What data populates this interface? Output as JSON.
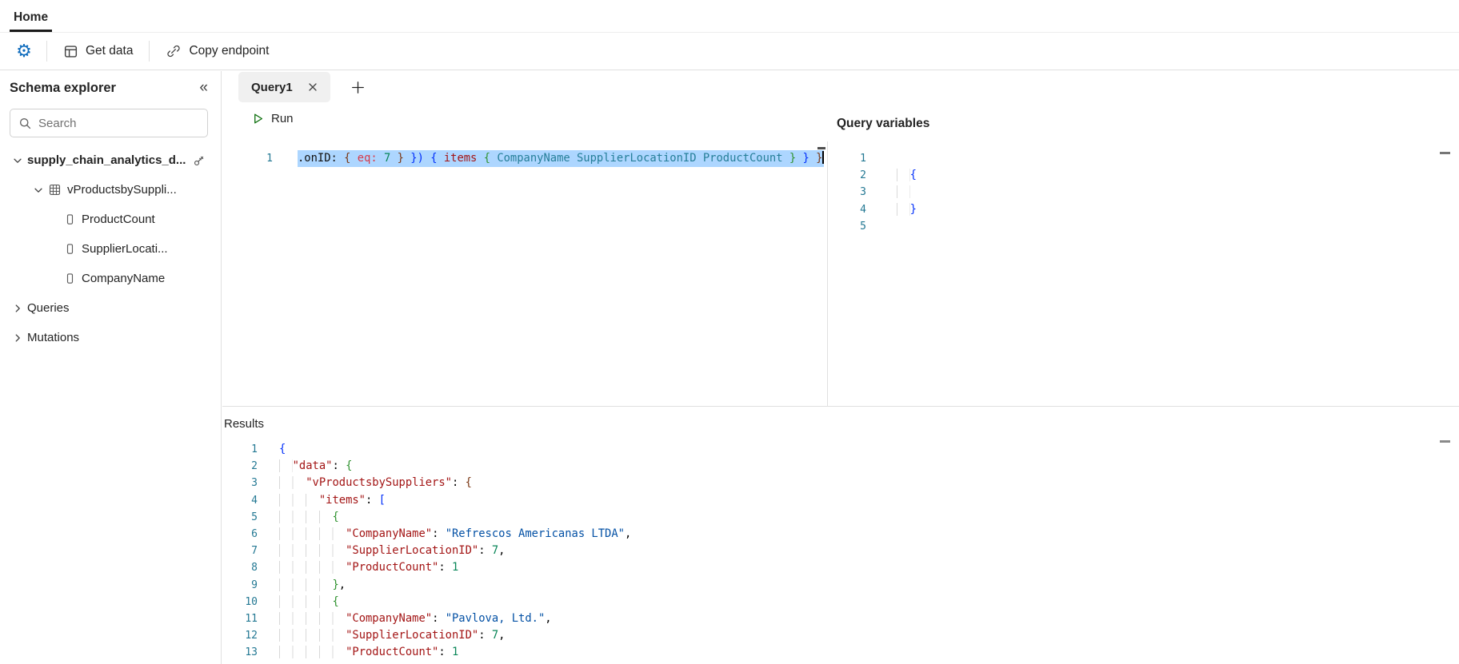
{
  "palette": {
    "accent": "#0f6cbd",
    "run_green": "#0e700e",
    "line_number": "#237893",
    "selection": "#add6ff"
  },
  "header": {
    "home_tab": "Home"
  },
  "toolbar": {
    "get_data": "Get data",
    "copy_endpoint": "Copy endpoint"
  },
  "sidebar": {
    "title": "Schema explorer",
    "search_placeholder": "Search",
    "tree": [
      {
        "label": "supply_chain_analytics_d...",
        "icon": "database-source",
        "expanded": true
      },
      {
        "label": "vProductsbySuppli...",
        "icon": "table",
        "expanded": true
      },
      {
        "label": "ProductCount",
        "icon": "column"
      },
      {
        "label": "SupplierLocati...",
        "icon": "column"
      },
      {
        "label": "CompanyName",
        "icon": "column"
      },
      {
        "label": "Queries",
        "expanded": false
      },
      {
        "label": "Mutations",
        "expanded": false
      }
    ]
  },
  "editor": {
    "tab_label": "Query1",
    "run_label": "Run",
    "query_variables_title": "Query variables",
    "query_lines": [
      {
        "sel": true,
        "caret": true,
        "tokens": [
          [
            ".onID:",
            "q"
          ],
          [
            " ",
            "q"
          ],
          [
            "{",
            "b3"
          ],
          [
            " ",
            "q"
          ],
          [
            "eq:",
            "arg"
          ],
          [
            " ",
            "q"
          ],
          [
            "7",
            "n"
          ],
          [
            " ",
            "q"
          ],
          [
            "}",
            "b3"
          ],
          [
            " ",
            "q"
          ],
          [
            "})",
            "b1"
          ],
          [
            " ",
            "q"
          ],
          [
            "{",
            "b1"
          ],
          [
            " ",
            "q"
          ],
          [
            "items",
            "k"
          ],
          [
            " ",
            "q"
          ],
          [
            "{",
            "b2"
          ],
          [
            " ",
            "q"
          ],
          [
            "CompanyName",
            "fld"
          ],
          [
            " ",
            "q"
          ],
          [
            "SupplierLocationID",
            "fld"
          ],
          [
            " ",
            "q"
          ],
          [
            "ProductCount",
            "fld"
          ],
          [
            " ",
            "q"
          ],
          [
            "}",
            "b2"
          ],
          [
            " ",
            "q"
          ],
          [
            "}",
            "b1"
          ],
          [
            " ",
            "q"
          ],
          [
            "}",
            "b3"
          ]
        ]
      }
    ],
    "variables_lines": [
      {
        "tokens": []
      },
      {
        "tokens": [
          [
            "  ",
            "ind"
          ],
          [
            "{",
            "b1"
          ]
        ]
      },
      {
        "tokens": [
          [
            "  ",
            "ind"
          ]
        ]
      },
      {
        "tokens": [
          [
            "  ",
            "ind"
          ],
          [
            "}",
            "b1"
          ]
        ]
      },
      {
        "tokens": []
      }
    ]
  },
  "results": {
    "title": "Results",
    "lines": [
      {
        "tokens": [
          [
            "{",
            "b1"
          ]
        ]
      },
      {
        "tokens": [
          [
            "  ",
            "ind"
          ],
          [
            "\"data\"",
            "k"
          ],
          [
            ": ",
            "p"
          ],
          [
            "{",
            "b2"
          ]
        ]
      },
      {
        "tokens": [
          [
            "    ",
            "ind"
          ],
          [
            "\"vProductsbySuppliers\"",
            "k"
          ],
          [
            ": ",
            "p"
          ],
          [
            "{",
            "b3"
          ]
        ]
      },
      {
        "tokens": [
          [
            "      ",
            "ind"
          ],
          [
            "\"items\"",
            "k"
          ],
          [
            ": ",
            "p"
          ],
          [
            "[",
            "b1"
          ]
        ]
      },
      {
        "tokens": [
          [
            "        ",
            "ind"
          ],
          [
            "{",
            "b2"
          ]
        ]
      },
      {
        "tokens": [
          [
            "          ",
            "ind"
          ],
          [
            "\"CompanyName\"",
            "k"
          ],
          [
            ": ",
            "p"
          ],
          [
            "\"Refrescos Americanas LTDA\"",
            "s"
          ],
          [
            ",",
            "p"
          ]
        ]
      },
      {
        "tokens": [
          [
            "          ",
            "ind"
          ],
          [
            "\"SupplierLocationID\"",
            "k"
          ],
          [
            ": ",
            "p"
          ],
          [
            "7",
            "n"
          ],
          [
            ",",
            "p"
          ]
        ]
      },
      {
        "tokens": [
          [
            "          ",
            "ind"
          ],
          [
            "\"ProductCount\"",
            "k"
          ],
          [
            ": ",
            "p"
          ],
          [
            "1",
            "n"
          ]
        ]
      },
      {
        "tokens": [
          [
            "        ",
            "ind"
          ],
          [
            "}",
            "b2"
          ],
          [
            ",",
            "p"
          ]
        ]
      },
      {
        "tokens": [
          [
            "        ",
            "ind"
          ],
          [
            "{",
            "b2"
          ]
        ]
      },
      {
        "tokens": [
          [
            "          ",
            "ind"
          ],
          [
            "\"CompanyName\"",
            "k"
          ],
          [
            ": ",
            "p"
          ],
          [
            "\"Pavlova, Ltd.\"",
            "s"
          ],
          [
            ",",
            "p"
          ]
        ]
      },
      {
        "tokens": [
          [
            "          ",
            "ind"
          ],
          [
            "\"SupplierLocationID\"",
            "k"
          ],
          [
            ": ",
            "p"
          ],
          [
            "7",
            "n"
          ],
          [
            ",",
            "p"
          ]
        ]
      },
      {
        "tokens": [
          [
            "          ",
            "ind"
          ],
          [
            "\"ProductCount\"",
            "k"
          ],
          [
            ": ",
            "p"
          ],
          [
            "1",
            "n"
          ]
        ]
      }
    ]
  }
}
